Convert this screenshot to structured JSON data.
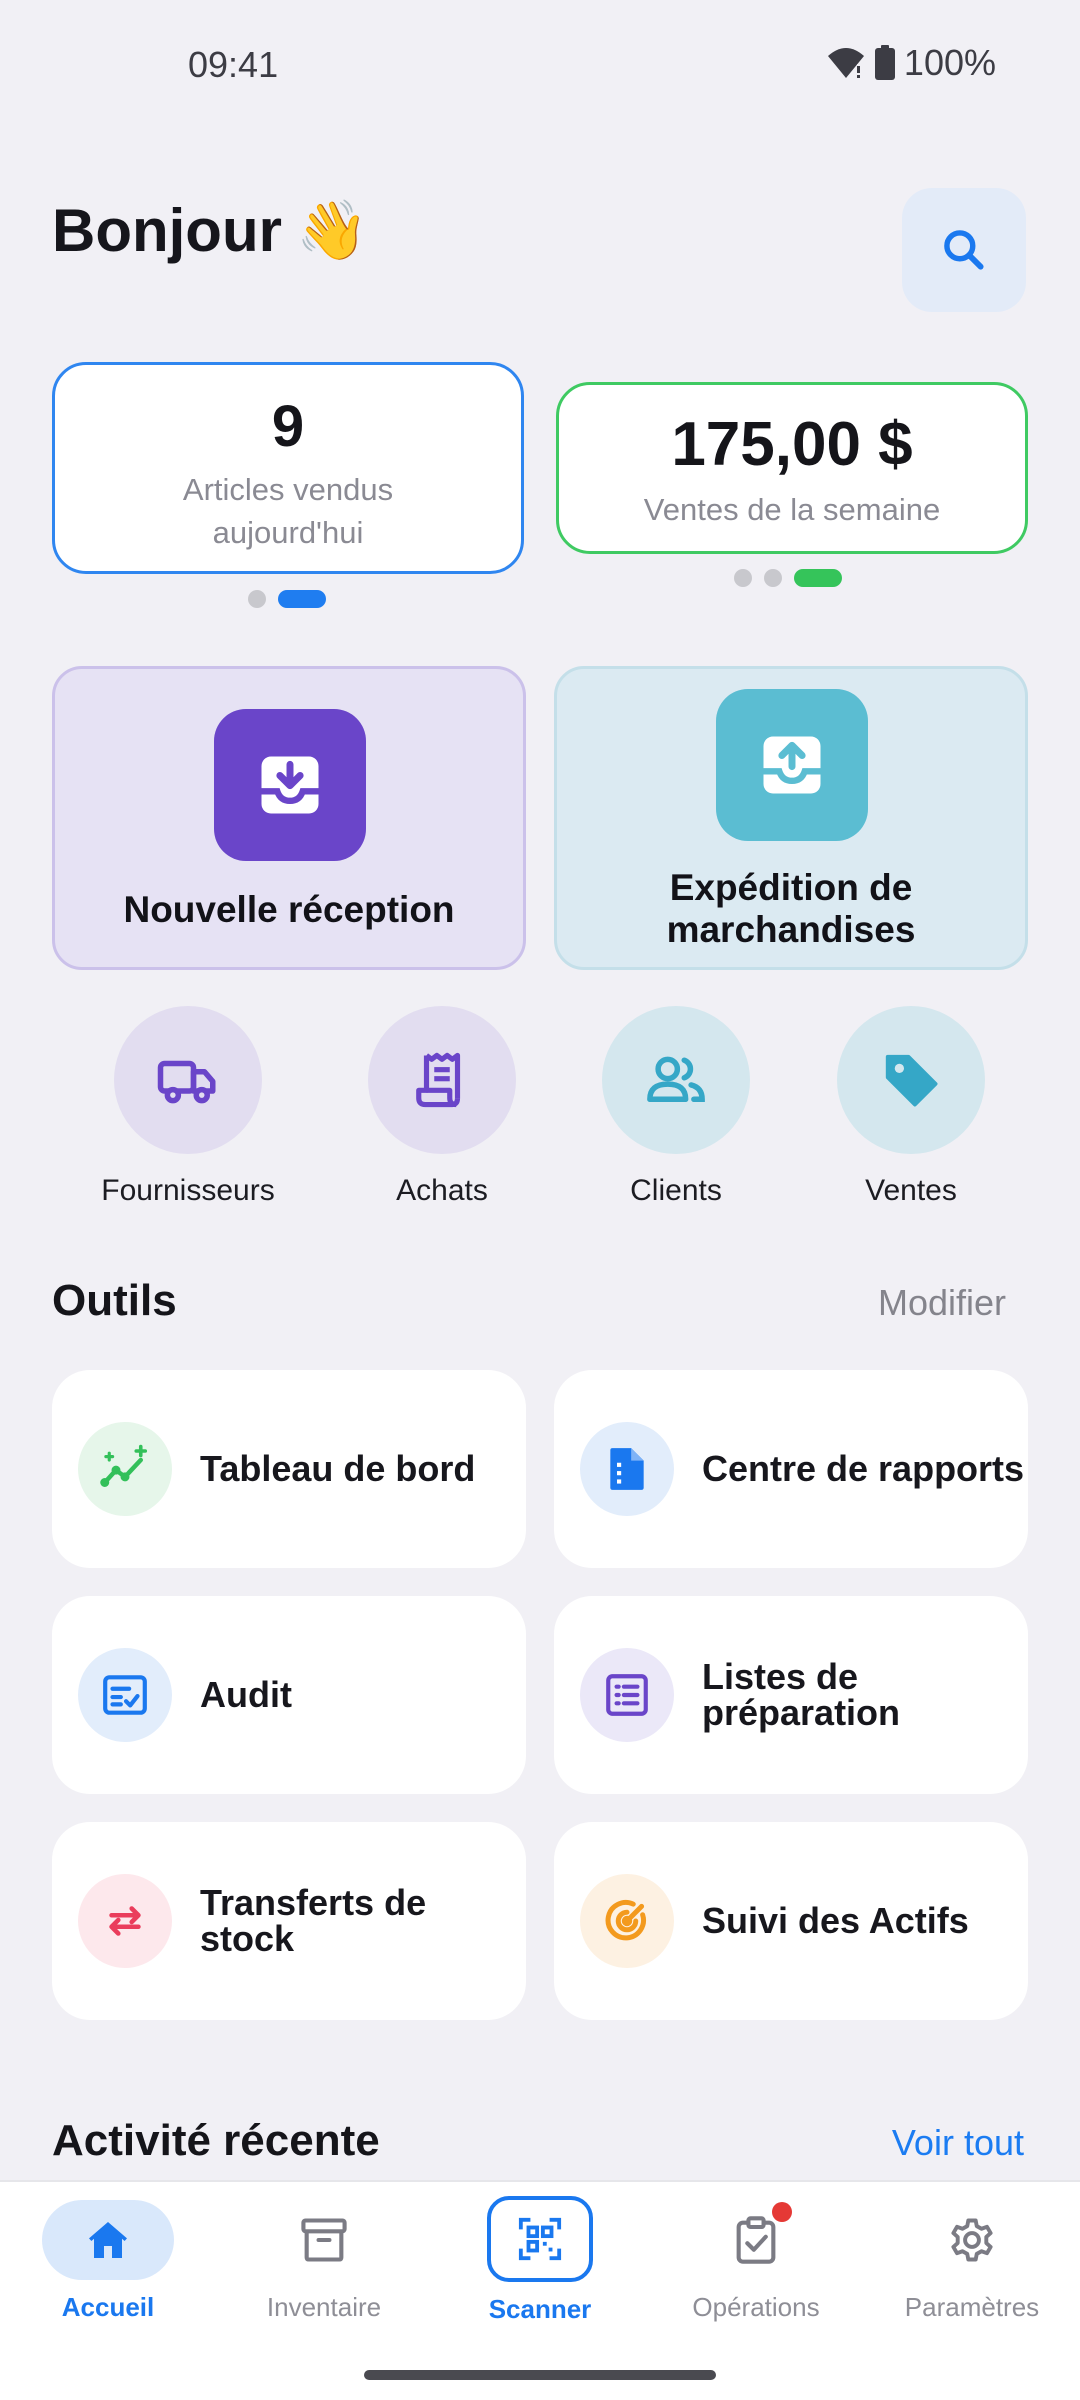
{
  "status_bar": {
    "time": "09:41",
    "battery": "100%"
  },
  "header": {
    "greeting": "Bonjour",
    "greeting_emoji": "👋",
    "search_icon": "search-icon"
  },
  "stats": [
    {
      "value": "9",
      "label": "Articles vendus aujourd'hui",
      "accent": "#2f86f0"
    },
    {
      "value": "175,00 $",
      "label": "Ventes de la semaine",
      "accent": "#3fca62"
    }
  ],
  "actions": [
    {
      "label": "Nouvelle réception",
      "icon": "inbox-download-icon",
      "color": "#6a45c9"
    },
    {
      "label": "Expédition de marchandises",
      "icon": "inbox-upload-icon",
      "color": "#5bbdd2"
    }
  ],
  "shortcuts": [
    {
      "label": "Fournisseurs",
      "icon": "truck-icon"
    },
    {
      "label": "Achats",
      "icon": "receipt-icon"
    },
    {
      "label": "Clients",
      "icon": "users-icon"
    },
    {
      "label": "Ventes",
      "icon": "tag-icon"
    }
  ],
  "tools": {
    "title": "Outils",
    "edit_label": "Modifier",
    "items": [
      {
        "label": "Tableau de bord",
        "icon": "chart-line-icon"
      },
      {
        "label": "Centre de rapports",
        "icon": "report-file-icon"
      },
      {
        "label": "Audit",
        "icon": "checklist-icon"
      },
      {
        "label": "Listes de préparation",
        "icon": "list-icon"
      },
      {
        "label": "Transferts de stock",
        "icon": "transfer-arrows-icon"
      },
      {
        "label": "Suivi des Actifs",
        "icon": "target-icon"
      }
    ]
  },
  "recent": {
    "title": "Activité récente",
    "see_all": "Voir tout"
  },
  "nav": {
    "items": [
      {
        "label": "Accueil",
        "icon": "home-icon",
        "active": true
      },
      {
        "label": "Inventaire",
        "icon": "archive-box-icon"
      },
      {
        "label": "Scanner",
        "icon": "qr-scan-icon"
      },
      {
        "label": "Opérations",
        "icon": "clipboard-check-icon"
      },
      {
        "label": "Paramètres",
        "icon": "gear-icon"
      }
    ]
  },
  "colors": {
    "primary": "#1a78ef",
    "background": "#f1f0f5"
  }
}
